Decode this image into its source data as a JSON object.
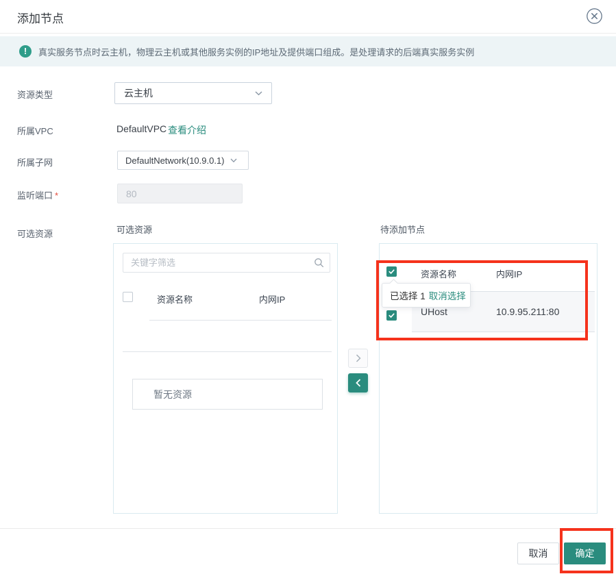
{
  "dialog": {
    "title": "添加节点"
  },
  "banner": {
    "text": "真实服务节点时云主机，物理云主机或其他服务实例的IP地址及提供端口组成。是处理请求的后端真实服务实例"
  },
  "form": {
    "resource_type": {
      "label": "资源类型",
      "value": "云主机"
    },
    "vpc": {
      "label": "所属VPC",
      "value": "DefaultVPC",
      "link": "查看介绍"
    },
    "subnet": {
      "label": "所属子网",
      "value": "DefaultNetwork(10.9.0.1)"
    },
    "listen_port": {
      "label": "监听端口",
      "required_mark": "*",
      "value": "80"
    },
    "resources_label": "可选资源"
  },
  "available_panel": {
    "title": "可选资源",
    "search_placeholder": "关键字筛选",
    "columns": [
      "资源名称",
      "内网IP"
    ],
    "empty_text": "暂无资源"
  },
  "selected_panel": {
    "title": "待添加节点",
    "columns": [
      "资源名称",
      "内网IP"
    ],
    "rows": [
      {
        "name": "UHost",
        "ip": "10.9.95.211:80"
      }
    ],
    "tooltip": {
      "selected_text": "已选择 1",
      "clear_link": "取消选择"
    }
  },
  "footer": {
    "cancel": "取消",
    "confirm": "确定"
  },
  "icons": {
    "close": "circle-x",
    "info": "exclamation-circle",
    "search": "magnifier",
    "dropdown": "chevron-down",
    "move_right": "chevron-right",
    "move_left": "chevron-left",
    "checked": "check-mark"
  },
  "colors": {
    "accent_teal": "#2a8c7e",
    "annotation_red": "#f5321c",
    "banner_bg": "#edf4f6",
    "panel_border": "#d9eaf0",
    "selected_row_bg": "#f6f7f9"
  }
}
